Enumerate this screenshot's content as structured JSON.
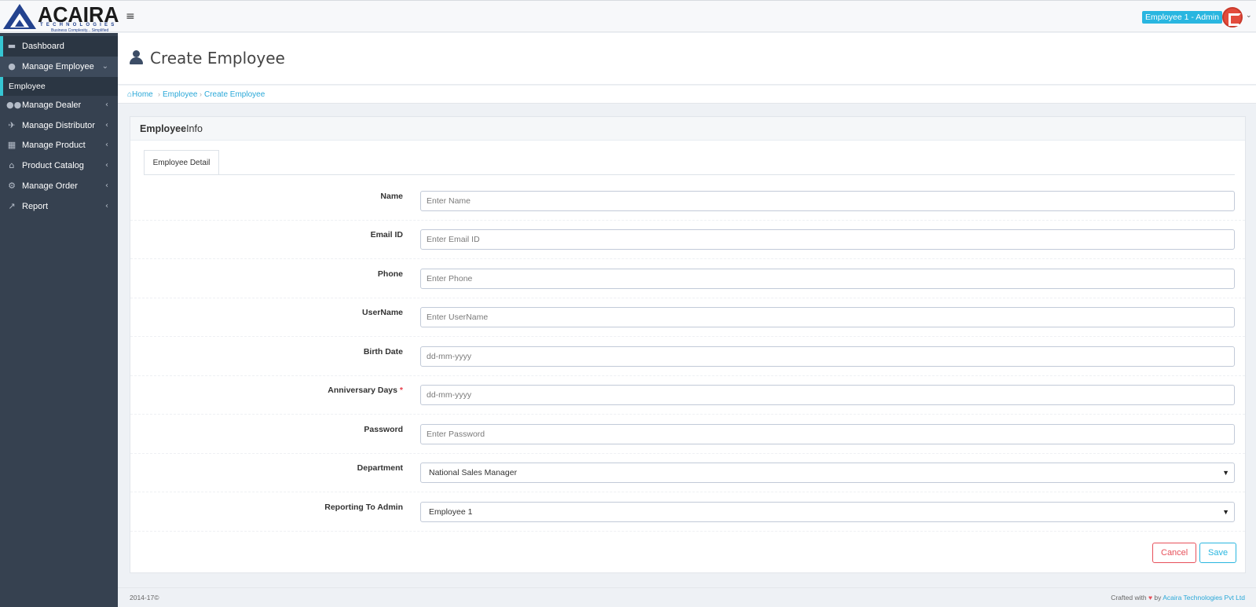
{
  "header": {
    "brand": "ACAIRA",
    "brand_sub": "TECHNOLOGIES",
    "brand_tagline": "Business Complexity... Simplified",
    "menu_icon": "hamburger-icon",
    "user_label": "Employee 1 - Admin",
    "avatar_icon": "user-avatar-icon"
  },
  "sidebar": {
    "items": [
      {
        "label": "Dashboard",
        "icon": "briefcase-icon"
      },
      {
        "label": "Manage Employee",
        "icon": "user-icon"
      },
      {
        "label": "Manage Dealer",
        "icon": "users-icon"
      },
      {
        "label": "Manage Distributor",
        "icon": "plane-icon"
      },
      {
        "label": "Manage Product",
        "icon": "grid-icon"
      },
      {
        "label": "Product Catalog",
        "icon": "home-icon"
      },
      {
        "label": "Manage Order",
        "icon": "bicycle-icon"
      },
      {
        "label": "Report",
        "icon": "chart-line-icon"
      }
    ],
    "sub_items": [
      {
        "label": "Employee"
      }
    ]
  },
  "page": {
    "title": "Create Employee"
  },
  "breadcrumb": [
    "Home",
    "Employee",
    "Create Employee"
  ],
  "portlet": {
    "title_bold": "Employee",
    "title_rest": "Info",
    "tab": "Employee Detail"
  },
  "form": {
    "fields": [
      {
        "label": "Name",
        "placeholder": "Enter Name",
        "value": ""
      },
      {
        "label": "Email ID",
        "placeholder": "Enter Email ID",
        "value": ""
      },
      {
        "label": "Phone",
        "placeholder": "Enter Phone",
        "value": ""
      },
      {
        "label": "UserName",
        "placeholder": "Enter UserName",
        "value": ""
      },
      {
        "label": "Birth Date",
        "placeholder": "dd-mm-yyyy",
        "value": ""
      },
      {
        "label": "Anniversary Days",
        "required": "*",
        "placeholder": "dd-mm-yyyy",
        "value": ""
      },
      {
        "label": "Password",
        "placeholder": "Enter Password",
        "value": ""
      },
      {
        "label": "Department",
        "selected": "National Sales Manager"
      },
      {
        "label": "Reporting To Admin",
        "selected": "Employee 1"
      }
    ],
    "cancel_label": "Cancel",
    "save_label": "Save"
  },
  "footer": {
    "left": "2014-17©",
    "crafted": "Crafted with",
    "by": "by",
    "company": "Acaira Technologies Pvt Ltd"
  },
  "colors": {
    "sidebar_bg": "#364150",
    "accent": "#29b6e0",
    "active_marker": "#36c6d3",
    "danger": "#e7505a"
  }
}
